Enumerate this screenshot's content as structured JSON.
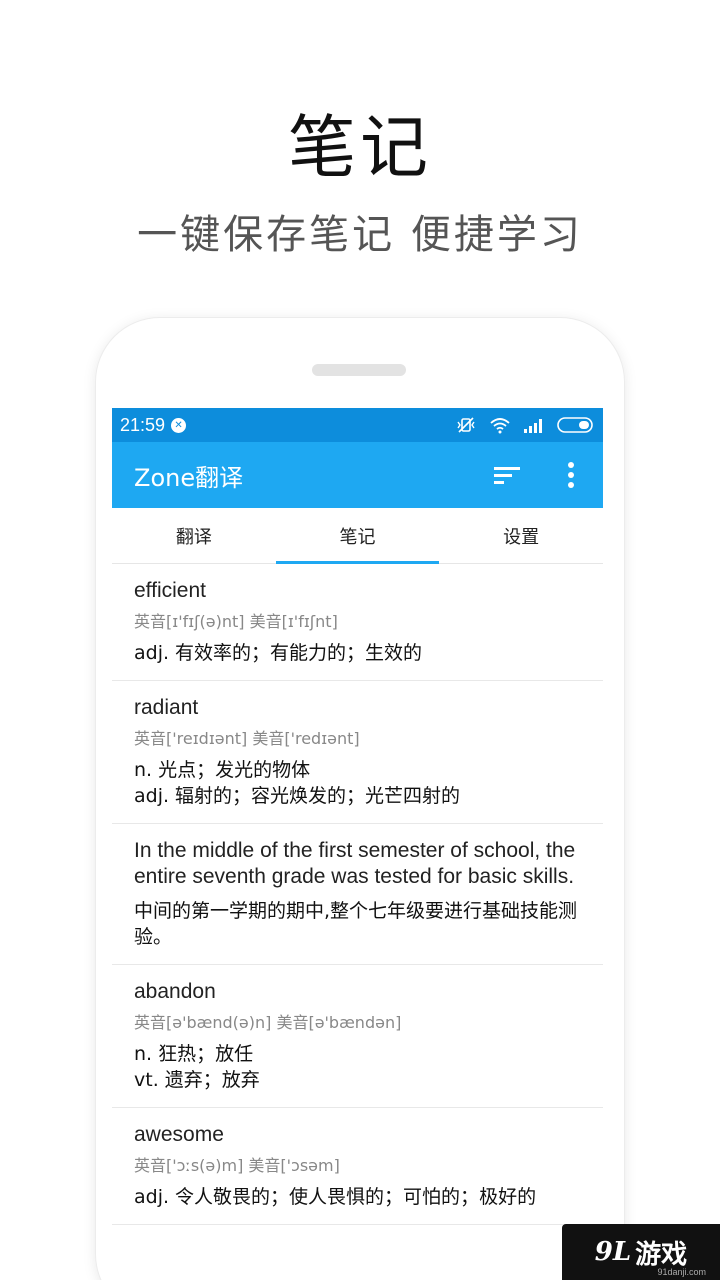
{
  "promo": {
    "title": "笔记",
    "subtitle": "一键保存笔记  便捷学习"
  },
  "status_bar": {
    "time": "21:59"
  },
  "app_bar": {
    "title": "Zone翻译",
    "accent_color": "#1ea8f2",
    "status_color": "#0d8ddc"
  },
  "tabs": [
    {
      "label": "翻译"
    },
    {
      "label": "笔记"
    },
    {
      "label": "设置"
    }
  ],
  "notes": [
    {
      "word": "efficient",
      "phonetic": "英音[ɪ'fɪʃ(ə)nt] 美音[ɪ'fɪʃnt]",
      "definitions": [
        "adj. 有效率的；有能力的；生效的"
      ]
    },
    {
      "word": "radiant",
      "phonetic": "英音['reɪdɪənt] 美音['redɪənt]",
      "definitions": [
        "n. 光点；发光的物体",
        "adj. 辐射的；容光焕发的；光芒四射的"
      ]
    },
    {
      "sentence": "In the middle of the first semester of school, the entire seventh grade was tested for basic skills.",
      "translation": "中间的第一学期的期中,整个七年级要进行基础技能测验。"
    },
    {
      "word": "abandon",
      "phonetic": "英音[ə'bænd(ə)n] 美音[ə'bændən]",
      "definitions": [
        "n. 狂热；放任",
        "vt. 遗弃；放弃"
      ]
    },
    {
      "word": "awesome",
      "phonetic": "英音['ɔːs(ə)m] 美音['ɔsəm]",
      "definitions": [
        "adj. 令人敬畏的；使人畏惧的；可怕的；极好的"
      ]
    }
  ],
  "watermark": {
    "number": "9L",
    "text": "游戏",
    "site": "91danji.com"
  }
}
